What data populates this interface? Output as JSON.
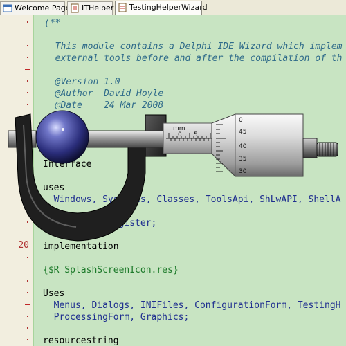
{
  "tabs": [
    {
      "label": "Welcome Page",
      "icon": "welcome-page-icon",
      "active": false
    },
    {
      "label": "ITHelper",
      "icon": "unit-file-icon",
      "active": false
    },
    {
      "label": "TestingHelperWizard",
      "icon": "unit-file-icon",
      "active": true
    }
  ],
  "gutter": {
    "line_number": "20"
  },
  "code": {
    "l1": "(**",
    "l3": "  This module contains a Delphi IDE Wizard which implem",
    "l4": "  external tools before and after the compilation of th",
    "l6": "  @Version 1.0",
    "l7": "  @Author  David Hoyle",
    "l8": "  @Date    24 Mar 2008",
    "l11_kw": "Interface",
    "l13_kw": "uses",
    "l14": "  Windows, SysUtils, Classes, ToolsApi, ShLwAPI, ShellA",
    "l16": "  ProcessingRegister;",
    "l18_kw": "implementation",
    "l20": "{$R SplashScreenIcon.res}",
    "l22_kw": "Uses",
    "l23": "  Menus, Dialogs, INIFiles, ConfigurationForm, TestingH",
    "l24": "  ProcessingForm, Graphics;",
    "l26_kw": "resourcestring"
  },
  "splash": {
    "unit_label": "mm",
    "sleeve_ticks": [
      "0",
      "5"
    ],
    "thimble_ticks": [
      "0",
      "45",
      "40",
      "35",
      "30"
    ]
  },
  "colors": {
    "editor_bg": "#c8e4c2",
    "gutter_bg": "#f2eedf",
    "comment": "#2f6b8a",
    "identifier": "#1f2f8f",
    "directive": "#1d7a2a"
  }
}
